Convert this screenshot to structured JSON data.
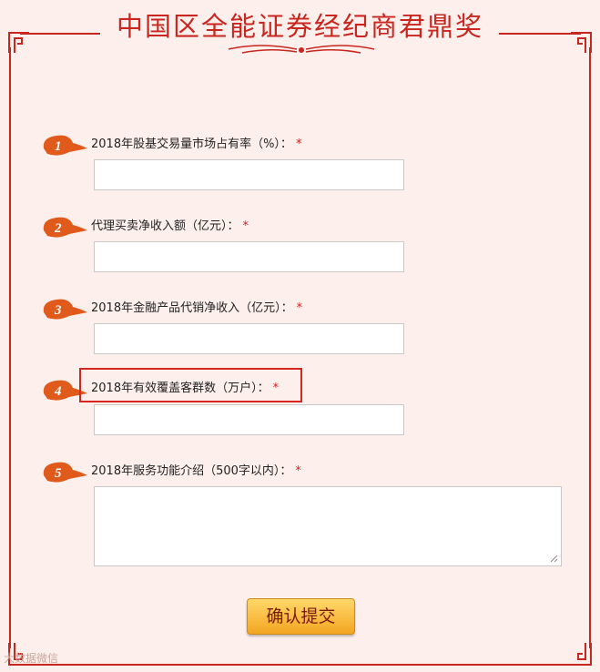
{
  "title": "中国区全能证券经纪商君鼎奖",
  "questions": [
    {
      "number": "1",
      "label": "2018年股基交易量市场占有率（%）："
    },
    {
      "number": "2",
      "label": "代理买卖净收入额（亿元）："
    },
    {
      "number": "3",
      "label": "2018年金融产品代销净收入（亿元）："
    },
    {
      "number": "4",
      "label": "2018年有效覆盖客群数（万户）："
    },
    {
      "number": "5",
      "label": "2018年服务功能介绍（500字以内）："
    }
  ],
  "required_mark": "*",
  "submit_label": "确认提交",
  "watermark": "大数据微信",
  "colors": {
    "accent": "#c8261f",
    "badge": "#e05a1c",
    "button": "#f3a521"
  }
}
